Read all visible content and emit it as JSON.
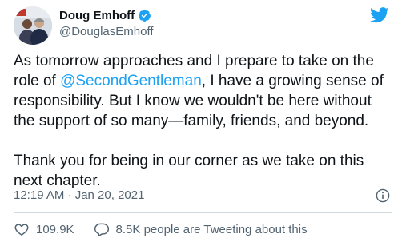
{
  "author": {
    "name": "Doug Emhoff",
    "handle": "@DouglasEmhoff"
  },
  "tweet": {
    "line1_before": "As tomorrow approaches and I prepare to take on the role of ",
    "mention": "@SecondGentleman",
    "line1_after": ", I have a growing sense of responsibility. But I know we wouldn't be here without the support of so many—family, friends, and beyond.",
    "paragraph2": "Thank you for being in our corner as we take on this next chapter.",
    "timestamp": "12:19 AM · Jan 20, 2021"
  },
  "actions": {
    "likes": "109.9K",
    "tweeting": "8.5K people are Tweeting about this"
  },
  "colors": {
    "accent": "#1da1f2",
    "text": "#0f1419",
    "secondary": "#536471",
    "divider": "#cfd9de"
  },
  "icons": [
    "verified-badge-icon",
    "twitter-bird-icon",
    "info-icon",
    "heart-icon",
    "comment-icon"
  ]
}
